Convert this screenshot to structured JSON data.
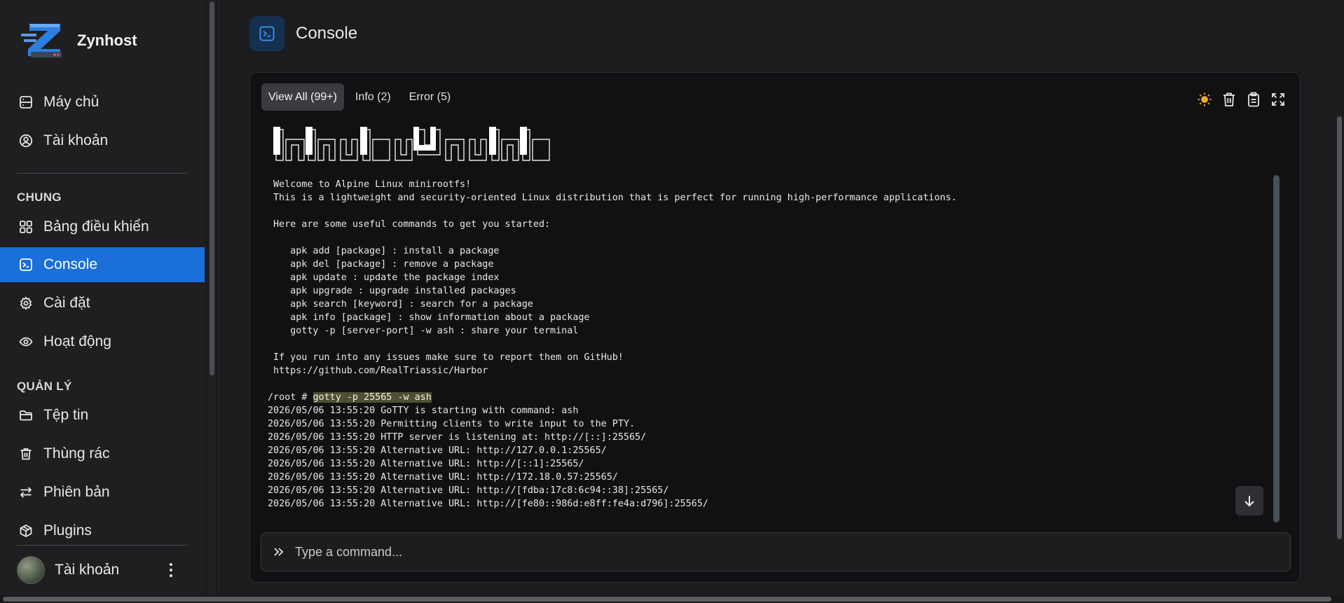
{
  "app": {
    "name": "Zynhost"
  },
  "sidebar": {
    "items_top": [
      {
        "label": "Máy chủ",
        "icon": "server-icon"
      },
      {
        "label": "Tài khoản",
        "icon": "user-circle-icon"
      }
    ],
    "section_general": "CHUNG",
    "items_general": [
      {
        "label": "Bảng điều khiển",
        "icon": "dashboard-grid-icon"
      },
      {
        "label": "Console",
        "icon": "terminal-icon",
        "active": true
      },
      {
        "label": "Cài đặt",
        "icon": "gear-icon"
      },
      {
        "label": "Hoạt động",
        "icon": "eye-icon"
      }
    ],
    "section_manage": "QUẢN LÝ",
    "items_manage": [
      {
        "label": "Tệp tin",
        "icon": "folder-icon"
      },
      {
        "label": "Thùng rác",
        "icon": "trash-icon"
      },
      {
        "label": "Phiên bản",
        "icon": "swap-arrows-icon"
      },
      {
        "label": "Plugins",
        "icon": "package-icon"
      }
    ],
    "account": {
      "label": "Tài khoản"
    }
  },
  "page": {
    "title": "Console"
  },
  "console": {
    "tabs": [
      {
        "label": "View All (99+)",
        "active": true
      },
      {
        "label": "Info (2)"
      },
      {
        "label": "Error (5)"
      }
    ],
    "tools": [
      "sun-icon",
      "trash-icon",
      "clipboard-icon",
      "expand-icon"
    ],
    "intro_lines": [
      "Welcome to Alpine Linux minirootfs!",
      "This is a lightweight and security-oriented Linux distribution that is perfect for running high-performance applications.",
      "",
      "Here are some useful commands to get you started:",
      "",
      "   apk add [package] : install a package",
      "   apk del [package] : remove a package",
      "   apk update : update the package index",
      "   apk upgrade : upgrade installed packages",
      "   apk search [keyword] : search for a package",
      "   apk info [package] : show information about a package",
      "   gotty -p [server-port] -w ash : share your terminal",
      "",
      "If you run into any issues make sure to report them on GitHub!",
      "https://github.com/RealTriassic/Harbor"
    ],
    "prompt": "/root # ",
    "command": "gotty -p 25565 -w ash",
    "log_lines": [
      "2026/05/06 13:55:20 GoTTY is starting with command: ash",
      "2026/05/06 13:55:20 Permitting clients to write input to the PTY.",
      "2026/05/06 13:55:20 HTTP server is listening at: http://[::]:25565/",
      "2026/05/06 13:55:20 Alternative URL: http://127.0.0.1:25565/",
      "2026/05/06 13:55:20 Alternative URL: http://[::1]:25565/",
      "2026/05/06 13:55:20 Alternative URL: http://172.18.0.57:25565/",
      "2026/05/06 13:55:20 Alternative URL: http://[fdba:17c8:6c94::38]:25565/",
      "2026/05/06 13:55:20 Alternative URL: http://[fe80::986d:e8ff:fe4a:d796]:25565/"
    ],
    "input_placeholder": "Type a command..."
  },
  "colors": {
    "accent": "#1a6fd8",
    "background": "#1c1c1f",
    "panel": "#111113",
    "sun": "#f2a62b"
  }
}
